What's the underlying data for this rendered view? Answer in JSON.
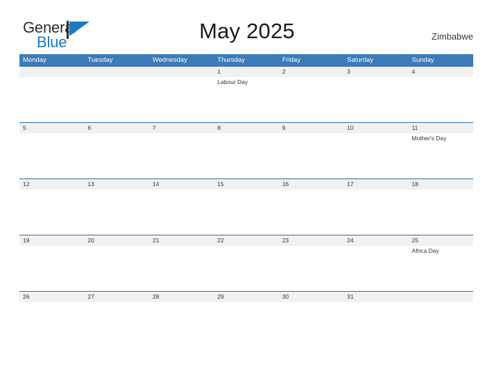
{
  "brand": {
    "name_part1": "General",
    "name_part2": "Blue",
    "logo_icon": "triangle-flag-icon",
    "accent_color": "#1b7ac4"
  },
  "header": {
    "title": "May 2025",
    "country": "Zimbabwe"
  },
  "theme": {
    "header_blue": "#3b7cb8",
    "rule_blue": "#2e6da4",
    "date_band_gray": "#f1f1f1",
    "text_color": "#333333"
  },
  "calendar": {
    "weekdays": [
      "Monday",
      "Tuesday",
      "Wednesday",
      "Thursday",
      "Friday",
      "Saturday",
      "Sunday"
    ],
    "weeks": [
      {
        "days": [
          {
            "date": "",
            "event": ""
          },
          {
            "date": "",
            "event": ""
          },
          {
            "date": "",
            "event": ""
          },
          {
            "date": "1",
            "event": "Labour Day"
          },
          {
            "date": "2",
            "event": ""
          },
          {
            "date": "3",
            "event": ""
          },
          {
            "date": "4",
            "event": ""
          }
        ]
      },
      {
        "days": [
          {
            "date": "5",
            "event": ""
          },
          {
            "date": "6",
            "event": ""
          },
          {
            "date": "7",
            "event": ""
          },
          {
            "date": "8",
            "event": ""
          },
          {
            "date": "9",
            "event": ""
          },
          {
            "date": "10",
            "event": ""
          },
          {
            "date": "11",
            "event": "Mother's Day"
          }
        ]
      },
      {
        "days": [
          {
            "date": "12",
            "event": ""
          },
          {
            "date": "13",
            "event": ""
          },
          {
            "date": "14",
            "event": ""
          },
          {
            "date": "15",
            "event": ""
          },
          {
            "date": "16",
            "event": ""
          },
          {
            "date": "17",
            "event": ""
          },
          {
            "date": "18",
            "event": ""
          }
        ]
      },
      {
        "days": [
          {
            "date": "19",
            "event": ""
          },
          {
            "date": "20",
            "event": ""
          },
          {
            "date": "21",
            "event": ""
          },
          {
            "date": "22",
            "event": ""
          },
          {
            "date": "23",
            "event": ""
          },
          {
            "date": "24",
            "event": ""
          },
          {
            "date": "25",
            "event": "Africa Day"
          }
        ]
      },
      {
        "days": [
          {
            "date": "26",
            "event": ""
          },
          {
            "date": "27",
            "event": ""
          },
          {
            "date": "28",
            "event": ""
          },
          {
            "date": "29",
            "event": ""
          },
          {
            "date": "30",
            "event": ""
          },
          {
            "date": "31",
            "event": ""
          },
          {
            "date": "",
            "event": ""
          }
        ]
      }
    ]
  }
}
